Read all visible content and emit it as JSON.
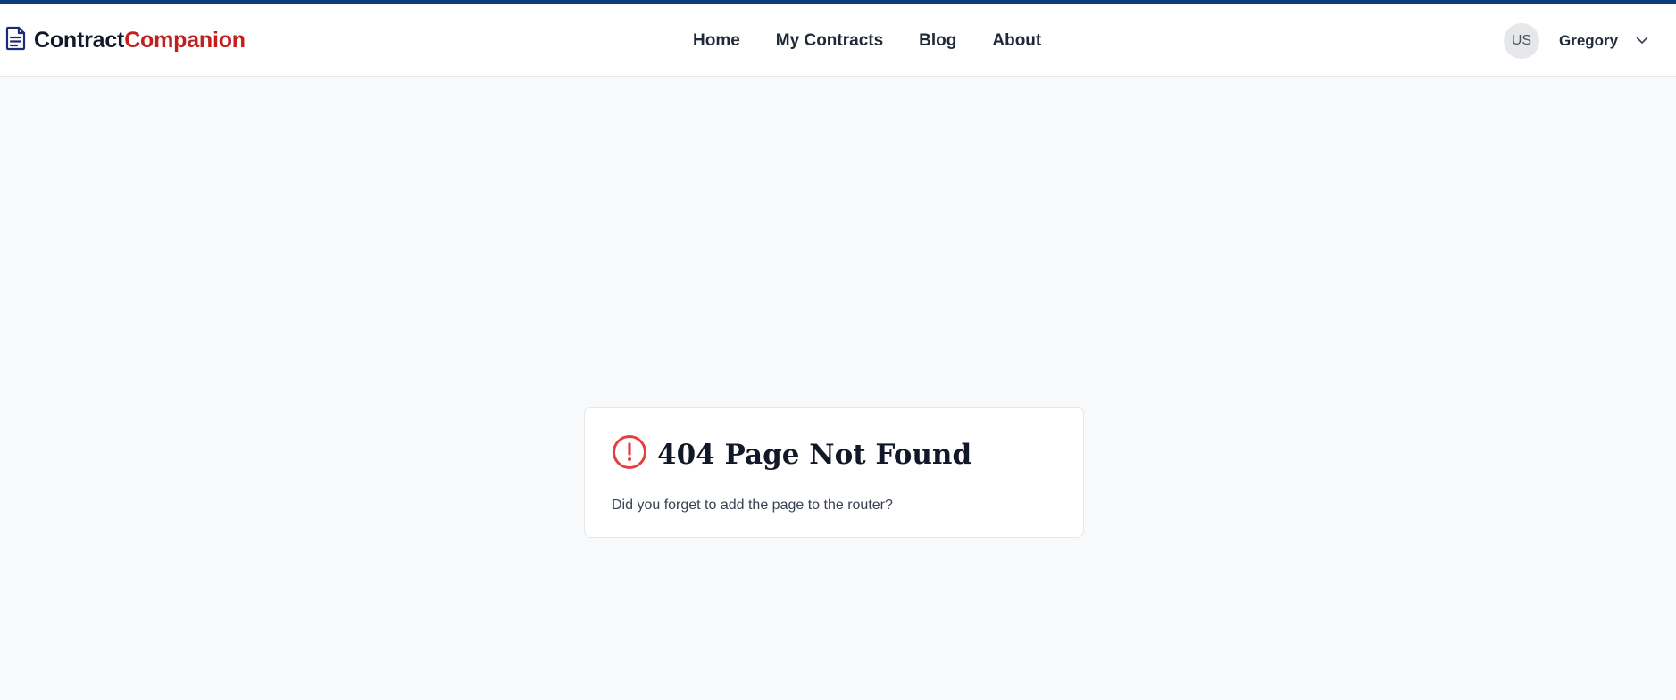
{
  "brand": {
    "name_part1": "Contract",
    "name_part2": "Companion",
    "accent": "#c21f1f",
    "icon": "document-icon"
  },
  "nav": {
    "items": [
      {
        "label": "Home"
      },
      {
        "label": "My Contracts"
      },
      {
        "label": "Blog"
      },
      {
        "label": "About"
      }
    ]
  },
  "user": {
    "initials": "US",
    "name": "Gregory",
    "menu_icon": "chevron-down-icon"
  },
  "error": {
    "icon": "alert-circle-icon",
    "icon_color": "#e53e3e",
    "title": "404 Page Not Found",
    "message": "Did you forget to add the page to the router?"
  },
  "colors": {
    "top_strip": "#0b3d7a",
    "background": "#f8f9fb"
  }
}
